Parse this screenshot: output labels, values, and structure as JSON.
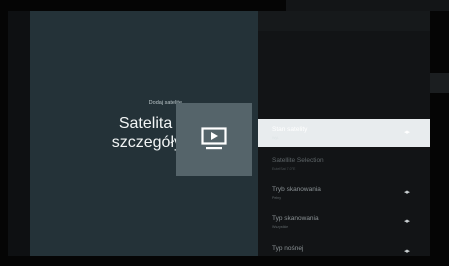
{
  "header": {
    "subtitle": "Dodaj satelitę",
    "title": "Satelita -\nszczegóły"
  },
  "hero_icon": "tv-play-icon",
  "colors": {
    "left_panel": "#243238",
    "right_panel": "#121416",
    "selected_item": "#e8ecee",
    "icon_box": "#55646a"
  },
  "settings": {
    "items": [
      {
        "label": "Stan satelity",
        "value": "Wył.",
        "has_arrows": true,
        "selected": true
      },
      {
        "label": "Satellite Selection",
        "value": "EutelSat 7.0°E",
        "has_arrows": false,
        "selected": false
      },
      {
        "label": "Tryb skanowania",
        "value": "Pełny",
        "has_arrows": true,
        "selected": false
      },
      {
        "label": "Typ skanowania",
        "value": "Wszystkie",
        "has_arrows": true,
        "selected": false
      },
      {
        "label": "Typ nośnej",
        "value": "",
        "has_arrows": true,
        "selected": false
      }
    ],
    "arrow_glyph": "◂▸"
  }
}
